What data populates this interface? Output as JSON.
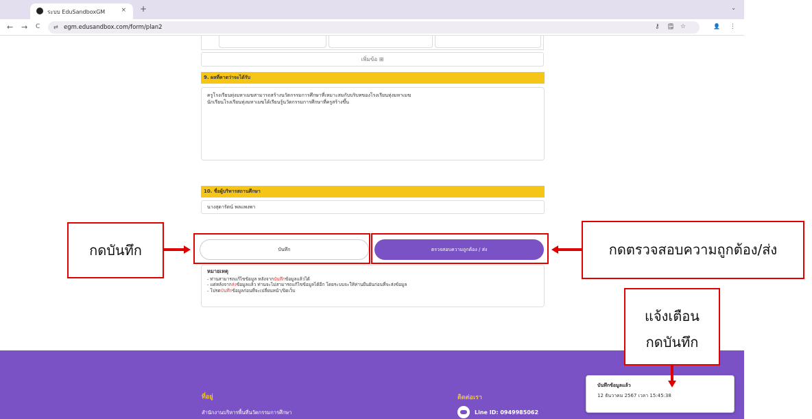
{
  "browser": {
    "tab_title": "ระบบ EduSandboxGM",
    "tab_close": "×",
    "new_tab": "+",
    "tab_menu": "⌄",
    "url": "egm.edusandbox.com/form/plan2",
    "back": "←",
    "forward": "→",
    "reload": "C",
    "site_icon": "⇄",
    "key_icon": "⚷",
    "translate_icon": "🗒",
    "star_icon": "☆",
    "profile_icon": "👤",
    "menu_icon": "⋮"
  },
  "form": {
    "add_row_label": "เพิ่มข้อ ⊞",
    "section9_title": "9. ผลที่คาดว่าจะได้รับ",
    "section9_lines": [
      "ครูโรงเรียนทุ่งมหาเมฆสามารถสร้างนวัตกรรมการศึกษาที่เหมาะสมกับบริบทของโรงเรียนทุ่งมหาเมฆ",
      "นักเรียนโรงเรียนทุ่งมหาเมฆได้เรียนรู้นวัตกรรมการศึกษาที่ครูสร้างขึ้น"
    ],
    "section10_title": "10. ชื่อผู้บริหารสถานศึกษา",
    "section10_value": "นางสุดารัตน์ พลแพงพา",
    "save_label": "บันทึก",
    "submit_label": "ตรวจสอบความถูกต้อง / ส่ง"
  },
  "note": {
    "title": "หมายเหตุ",
    "l1a": "- ท่านสามารถแก้ไขข้อมูล หลังจาก",
    "l1b": "บันทึก",
    "l1c": "ข้อมูลแล้วได้",
    "l2a": "- แต่หลังจาก",
    "l2b": "ส่ง",
    "l2c": "ข้อมูลแล้ว ท่านจะไม่สามารถแก้ไขข้อมูลได้อีก โดยระบบจะให้ท่านยืนยันก่อนที่จะส่งข้อมูล",
    "l3a": "- โปรด",
    "l3b": "บันทึก",
    "l3c": "ข้อมูลก่อนที่จะเปลี่ยนหน้า/ปิดเว็บ"
  },
  "footer": {
    "address_heading": "ที่อยู่",
    "address_text": "สำนักงานบริหารพื้นที่นวัตกรรมการศึกษา",
    "contact_heading": "ติดต่อเรา",
    "line_id": "Line ID: 0949985062"
  },
  "toast": {
    "title": "บันทึกข้อมูลแล้ว",
    "timestamp": "12 ธันวาคม 2567 เวลา 15:45:38"
  },
  "annotations": {
    "save_callout": "กดบันทึก",
    "submit_callout": "กดตรวจสอบความถูกต้อง/ส่ง",
    "toast_callout_1": "แจ้งเตือน",
    "toast_callout_2": "กดบันทึก"
  },
  "colors": {
    "accent_purple": "#7a52c6",
    "section_yellow": "#f5c518",
    "annotation_red": "#e00000"
  }
}
